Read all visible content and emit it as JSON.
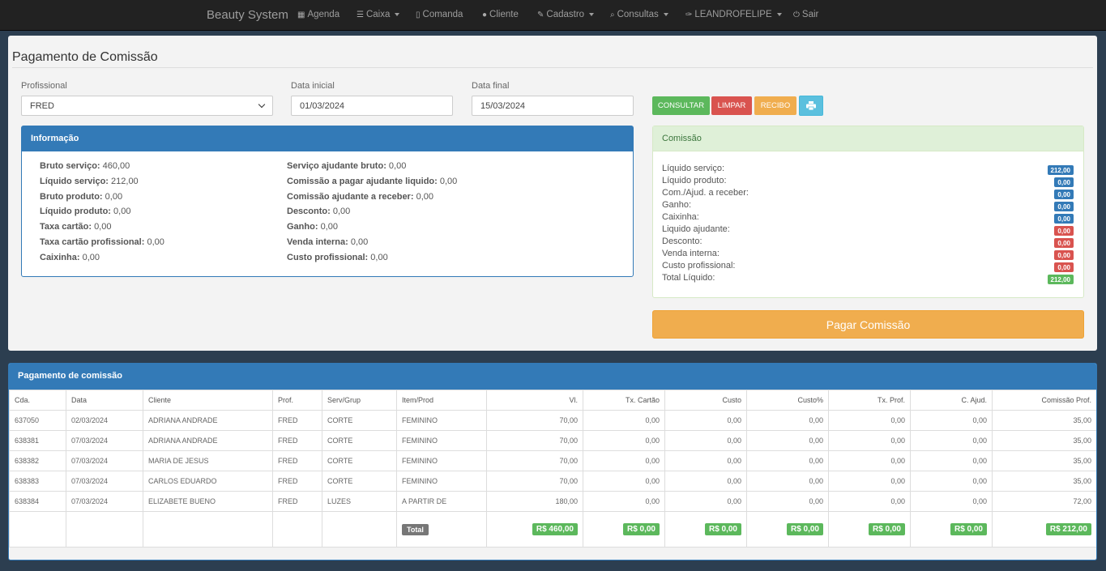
{
  "nav": {
    "brand": "Beauty System",
    "agenda": "Agenda",
    "caixa": "Caixa",
    "comanda": "Comanda",
    "cliente": "Cliente",
    "cadastro": "Cadastro",
    "consultas": "Consultas",
    "user": "LEANDROFELIPE",
    "sair": "Sair"
  },
  "page": {
    "title": "Pagamento de Comissão"
  },
  "form": {
    "profissional_label": "Profissional",
    "profissional_value": "FRED",
    "data_inicial_label": "Data inicial",
    "data_inicial_value": "01/03/2024",
    "data_final_label": "Data final",
    "data_final_value": "15/03/2024"
  },
  "buttons": {
    "consultar": "CONSULTAR",
    "limpar": "LIMPAR",
    "recibo": "RECIBO",
    "pagar": "Pagar Comissão"
  },
  "info": {
    "title": "Informação",
    "left": [
      {
        "label": "Bruto serviço:",
        "value": "460,00"
      },
      {
        "label": "Líquido serviço:",
        "value": "212,00"
      },
      {
        "label": "Bruto produto:",
        "value": "0,00"
      },
      {
        "label": "Líquido produto:",
        "value": "0,00"
      },
      {
        "label": "Taxa cartão:",
        "value": "0,00"
      },
      {
        "label": "Taxa cartão profissional:",
        "value": "0,00"
      },
      {
        "label": "Caixinha:",
        "value": "0,00"
      }
    ],
    "right": [
      {
        "label": "Serviço ajudante bruto:",
        "value": "0,00"
      },
      {
        "label": "Comissão a pagar ajudante liquido:",
        "value": "0,00"
      },
      {
        "label": "Comissão ajudante a receber:",
        "value": "0,00"
      },
      {
        "label": "Desconto:",
        "value": "0,00"
      },
      {
        "label": "Ganho:",
        "value": "0,00"
      },
      {
        "label": "Venda interna:",
        "value": "0,00"
      },
      {
        "label": "Custo profissional:",
        "value": "0,00"
      }
    ]
  },
  "comissao": {
    "title": "Comissão",
    "rows": [
      {
        "label": "Líquido serviço:",
        "value": "212,00",
        "color": "#337ab7"
      },
      {
        "label": "Líquido produto:",
        "value": "0,00",
        "color": "#337ab7"
      },
      {
        "label": "Com./Ajud. a receber:",
        "value": "0,00",
        "color": "#337ab7"
      },
      {
        "label": "Ganho:",
        "value": "0,00",
        "color": "#337ab7"
      },
      {
        "label": "Caixinha:",
        "value": "0,00",
        "color": "#337ab7"
      },
      {
        "label": "Liquido ajudante:",
        "value": "0,00",
        "color": "#d9534f"
      },
      {
        "label": "Desconto:",
        "value": "0,00",
        "color": "#d9534f"
      },
      {
        "label": "Venda interna:",
        "value": "0,00",
        "color": "#d9534f"
      },
      {
        "label": "Custo profissional:",
        "value": "0,00",
        "color": "#d9534f"
      },
      {
        "label": "Total Líquido:",
        "value": "212,00",
        "color": "#5cb85c"
      }
    ]
  },
  "table": {
    "title": "Pagamento de comissão",
    "headers": [
      "Cda.",
      "Data",
      "Cliente",
      "Prof.",
      "Serv/Grup",
      "Item/Prod",
      "Vl.",
      "Tx. Cartão",
      "Custo",
      "Custo%",
      "Tx. Prof.",
      "C. Ajud.",
      "Comissão Prof."
    ],
    "rows": [
      [
        "637050",
        "02/03/2024",
        "ADRIANA ANDRADE",
        "FRED",
        "CORTE",
        "FEMININO",
        "70,00",
        "0,00",
        "0,00",
        "0,00",
        "0,00",
        "0,00",
        "35,00"
      ],
      [
        "638381",
        "07/03/2024",
        "ADRIANA ANDRADE",
        "FRED",
        "CORTE",
        "FEMININO",
        "70,00",
        "0,00",
        "0,00",
        "0,00",
        "0,00",
        "0,00",
        "35,00"
      ],
      [
        "638382",
        "07/03/2024",
        "MARIA DE JESUS",
        "FRED",
        "CORTE",
        "FEMININO",
        "70,00",
        "0,00",
        "0,00",
        "0,00",
        "0,00",
        "0,00",
        "35,00"
      ],
      [
        "638383",
        "07/03/2024",
        "CARLOS EDUARDO",
        "FRED",
        "CORTE",
        "FEMININO",
        "70,00",
        "0,00",
        "0,00",
        "0,00",
        "0,00",
        "0,00",
        "35,00"
      ],
      [
        "638384",
        "07/03/2024",
        "ELIZABETE BUENO",
        "FRED",
        "LUZES",
        "A PARTIR DE",
        "180,00",
        "0,00",
        "0,00",
        "0,00",
        "0,00",
        "0,00",
        "72,00"
      ]
    ],
    "total_label": "Total",
    "totals": [
      "R$ 460,00",
      "R$ 0,00",
      "R$ 0,00",
      "R$ 0,00",
      "R$ 0,00",
      "R$ 0,00",
      "R$ 212,00"
    ]
  }
}
